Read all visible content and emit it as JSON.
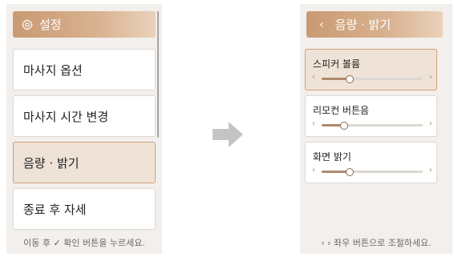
{
  "left_screen": {
    "header": {
      "title": "설정",
      "icon": "gear-icon"
    },
    "menu_items": [
      {
        "label": "마사지 옵션",
        "selected": false
      },
      {
        "label": "마사지 시간 변경",
        "selected": false
      },
      {
        "label": "음량 · 밝기",
        "selected": true
      },
      {
        "label": "종료 후 자세",
        "selected": false
      }
    ],
    "footer": {
      "prefix": "이동 후",
      "check": "✓",
      "suffix": "확인 버튼을 누르세요."
    }
  },
  "right_screen": {
    "header": {
      "back": "‹",
      "title": "음량 · 밝기"
    },
    "settings": [
      {
        "label": "스피커 볼륨",
        "level": 0.28,
        "selected": true
      },
      {
        "label": "리모컨 버튼음",
        "level": 0.22,
        "selected": false
      },
      {
        "label": "화면 밝기",
        "level": 0.28,
        "selected": false
      }
    ],
    "slider_left": "‹",
    "slider_right": "›",
    "footer": "‹ › 좌우 버튼으로 조절하세요."
  },
  "colors": {
    "accent": "#c89a72",
    "selected_bg": "#efe3d7",
    "panel_bg": "#f2efec",
    "arrow": "#c4c4c4"
  }
}
